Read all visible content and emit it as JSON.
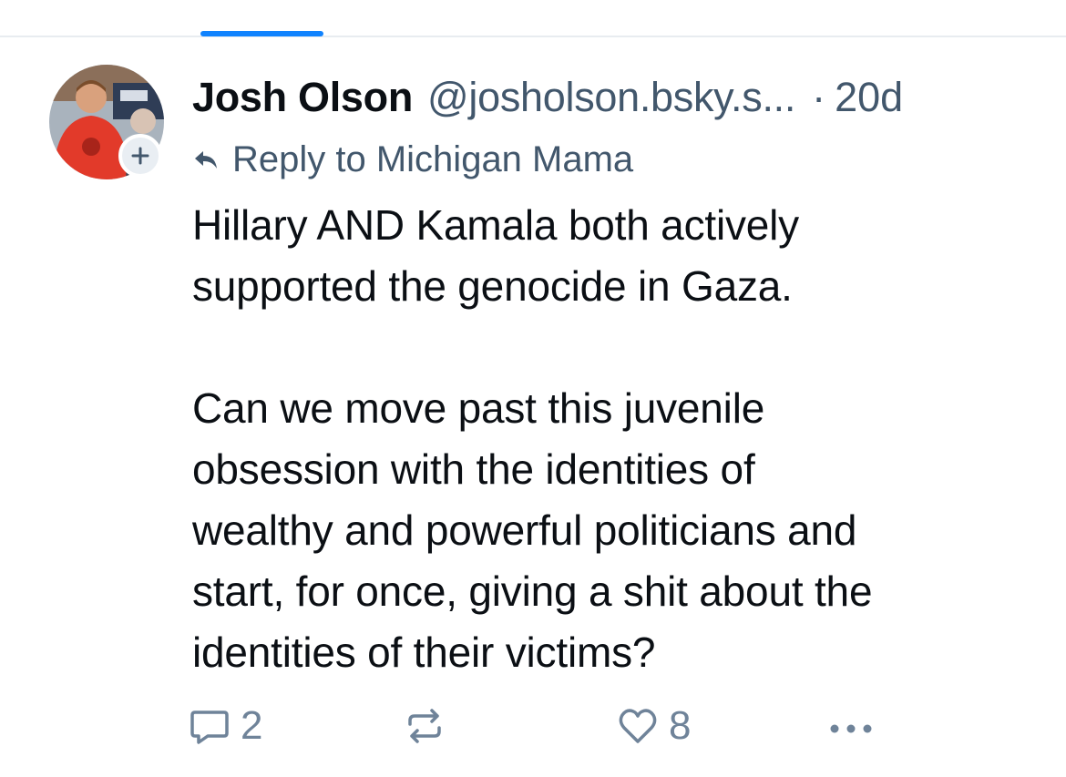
{
  "post": {
    "author": {
      "display_name": "Josh Olson",
      "handle": "@josholson.bsky.s...",
      "avatar": "profile-photo"
    },
    "separator": "·",
    "timestamp": "20d",
    "reply_to": "Reply to Michigan Mama",
    "body": "Hillary AND Kamala both actively\nsupported the genocide in Gaza.\n\nCan we move past this juvenile\nobsession with the identities of\nwealthy and powerful politicians and\nstart, for once, giving a shit about the\nidentities of their victims?",
    "actions": {
      "reply_count": "2",
      "repost_count": "",
      "like_count": "8"
    }
  },
  "icons": {
    "follow": "plus-icon",
    "reply_to": "reply-arrow-icon",
    "reply": "speech-bubble-icon",
    "repost": "repost-icon",
    "like": "heart-icon",
    "more": "more-horizontal-icon"
  },
  "colors": {
    "accent": "#1083fe",
    "text_primary": "#0b0f14",
    "text_secondary": "#42576c",
    "icon_muted": "#6f8399",
    "divider": "#e8ecf0"
  }
}
